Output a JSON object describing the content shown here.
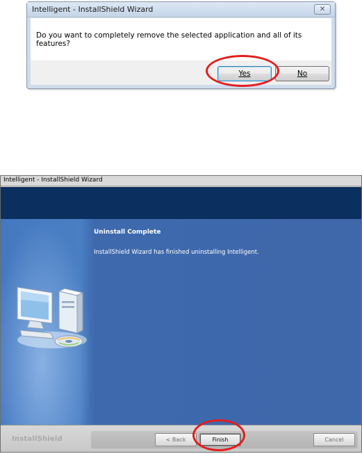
{
  "confirm_dialog": {
    "title": "Intelligent - InstallShield Wizard",
    "close_glyph": "✕",
    "message": "Do you want to completely remove the selected application and all of its features?",
    "yes_label": "Yes",
    "no_label": "No"
  },
  "wizard": {
    "title": "Intelligent - InstallShield Wizard",
    "heading": "Uninstall Complete",
    "message": "InstallShield Wizard has finished uninstalling Intelligent.",
    "brand": "InstallShield",
    "back_label": "< Back",
    "finish_label": "Finish",
    "cancel_label": "Cancel",
    "illustration_icon": "computer-with-cd-icon"
  },
  "highlight_color": "#e31d1d"
}
